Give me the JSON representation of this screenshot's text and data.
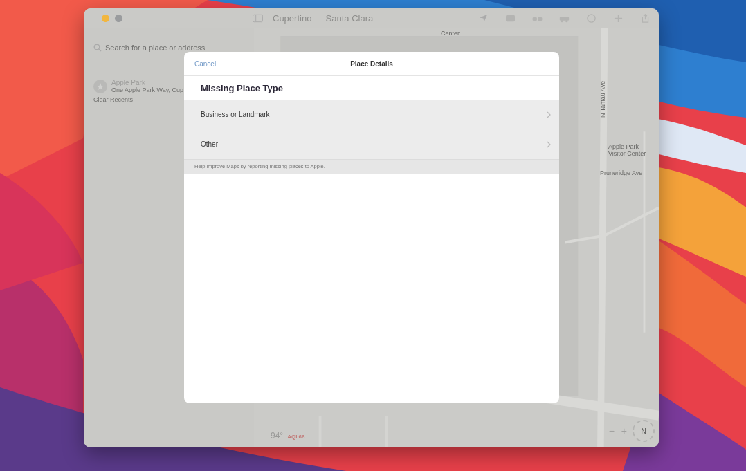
{
  "window": {
    "title": "Cupertino — Santa Clara"
  },
  "sidebar": {
    "search": {
      "placeholder": "Search for a place or address"
    },
    "recents": [
      {
        "title": "Apple Park",
        "subtitle": "One Apple Park Way, Cup"
      }
    ],
    "clear_recents": "Clear Recents"
  },
  "map": {
    "labels": [
      "Center",
      "Apple Park Visitor Center",
      "Pruneridge Ave",
      "N Tantau Ave"
    ],
    "temperature": "94°",
    "aqi": "AQI 66",
    "compass": "N",
    "zoom_out": "−",
    "zoom_in": "+"
  },
  "sheet": {
    "cancel": "Cancel",
    "title": "Place Details",
    "section_title": "Missing Place Type",
    "options": [
      {
        "label": "Business or Landmark"
      },
      {
        "label": "Other"
      }
    ],
    "footer": "Help improve Maps by reporting missing places to Apple."
  }
}
